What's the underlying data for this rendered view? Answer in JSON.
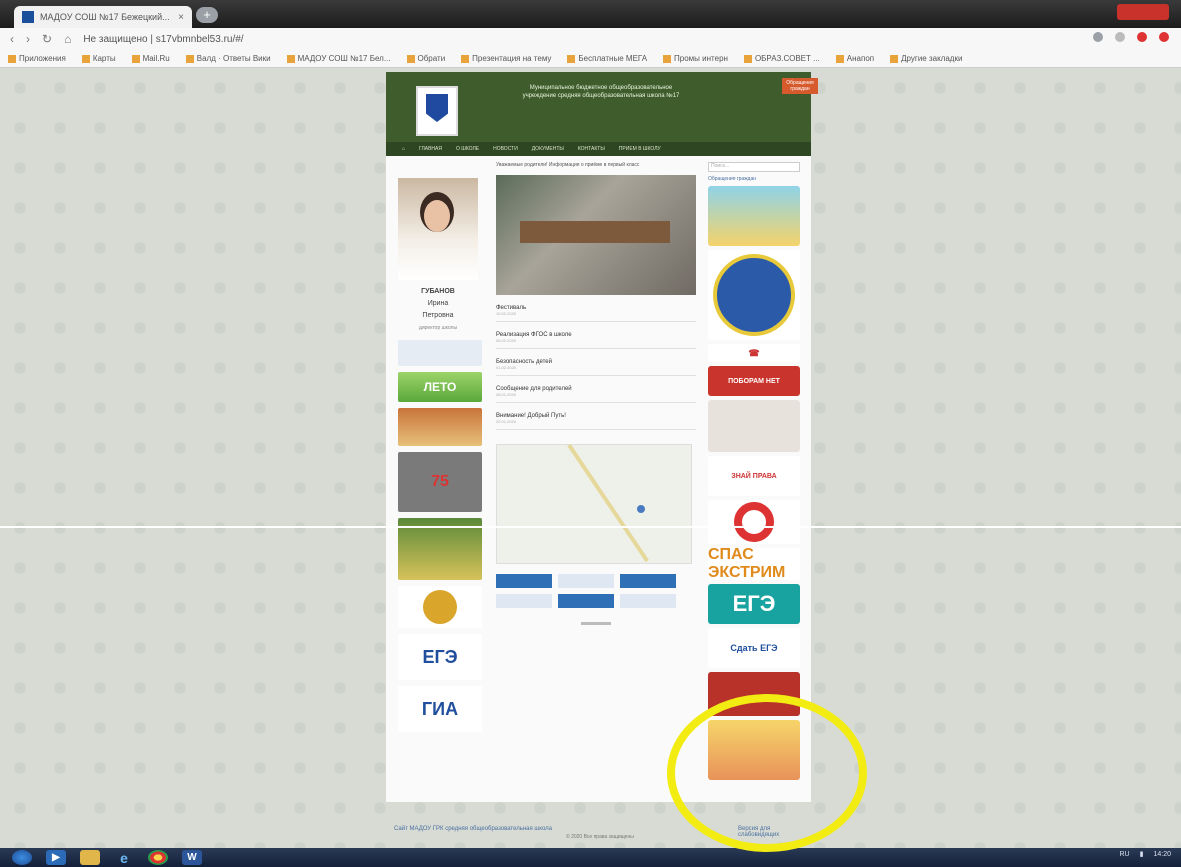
{
  "browser": {
    "tab_title": "МАДОУ СОШ №17 Бежецкий...",
    "tab_close": "×",
    "new_tab": "+",
    "url": "Не защищено | s17vbmnbel53.ru/#/",
    "bookmarks": [
      "Приложения",
      "Карты",
      "Mail.Ru",
      "Валд · Ответы Вики",
      "МАДОУ СОШ №17 Бел...",
      "Обрати",
      "Презентация на тему",
      "Бесплатные МЕГА",
      "Промы интерн",
      "ОБРАЗ.СОВЕТ ...",
      "Анапоп",
      "Другие закладки"
    ]
  },
  "site": {
    "header_text": "Муниципальное бюджетное общеобразовательное учреждение средняя общеобразовательная школа №17",
    "badge": "Обращения граждан",
    "nav": [
      "ГЛАВНАЯ",
      "О ШКОЛЕ",
      "НОВОСТИ",
      "ДОКУМЕНТЫ",
      "КОНТАКТЫ",
      "ПРИЕМ В ШКОЛУ"
    ],
    "director": {
      "surname": "ГУБАНОВ",
      "name": "Ирина",
      "patronymic": "Петровна",
      "role": "директор школы"
    },
    "center_intro": "Уважаемые родители! Информация о приёме в первый класс",
    "news": [
      {
        "title": "Фестиваль",
        "date": "10.02.2020"
      },
      {
        "title": "Реализация ФГОС в школе",
        "date": "05.02.2020"
      },
      {
        "title": "Безопасность детей",
        "date": "01.02.2020"
      },
      {
        "title": "Сообщение для родителей",
        "date": "28.01.2020"
      },
      {
        "title": "Внимание! Добрый Путь!",
        "date": "20.01.2020"
      }
    ],
    "search_placeholder": "Поиск...",
    "right_link": "Обращения граждан",
    "right_banners": [
      "ЕГЭ",
      "СПАС ЭКСТРИМ",
      "Сдать ЕГЭ",
      "ПОБОРАМ НЕТ",
      "ЗНАЙ ПРАВА"
    ],
    "left_banners": [
      "ЛЕТО",
      "75",
      "ЕГЭ",
      "ГИА"
    ],
    "footer_left": "Сайт МАДОУ ГРК средняя общеобразовательная школа",
    "footer_right": "Версия для слабовидящих",
    "copyright": "© 2020 Все права защищены"
  },
  "taskbar": {
    "tray_lang": "RU",
    "tray_time": "14:20"
  }
}
